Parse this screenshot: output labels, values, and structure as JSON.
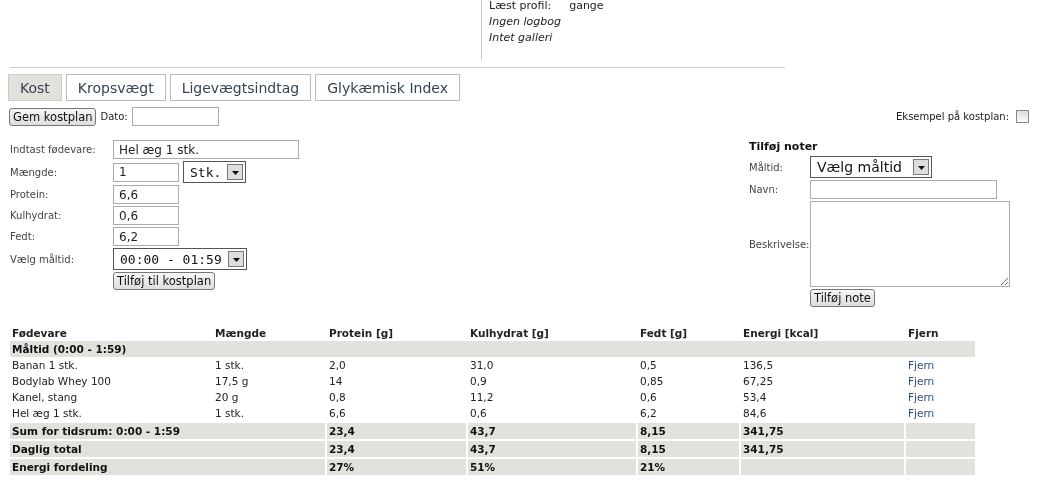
{
  "profile": {
    "stat": {
      "label": "Læst profil:",
      "value": "gange"
    },
    "links": [
      "Ingen logbog",
      "Intet galleri"
    ]
  },
  "tabs": [
    {
      "label": "Kost",
      "selected": true
    },
    {
      "label": "Kropsvægt",
      "selected": false
    },
    {
      "label": "Ligevægtsindtag",
      "selected": false
    },
    {
      "label": "Glykæmisk Index",
      "selected": false
    }
  ],
  "toolbar": {
    "save_button": "Gem kostplan",
    "date_label": "Dato:",
    "example": {
      "label": "Eksempel på kostplan:",
      "checked": false
    }
  },
  "food_form": {
    "fields": [
      {
        "kind": "text",
        "label": "Indtast fødevare:",
        "value": "Hel æg 1 stk."
      },
      {
        "kind": "amount",
        "label": "Mængde:",
        "value": "1",
        "unit": "Stk."
      },
      {
        "kind": "number",
        "label": "Protein:",
        "value": "6,6"
      },
      {
        "kind": "number",
        "label": "Kulhydrat:",
        "value": "0,6"
      },
      {
        "kind": "number",
        "label": "Fedt:",
        "value": "6,2"
      },
      {
        "kind": "select",
        "label": "Vælg måltid:",
        "value": "00:00 - 01:59"
      }
    ],
    "button": "Tilføj til kostplan"
  },
  "notes": {
    "title": "Tilføj noter",
    "fields": [
      {
        "kind": "select",
        "label": "Måltid:",
        "value": "Vælg måltid"
      },
      {
        "kind": "text",
        "label": "Navn:"
      },
      {
        "kind": "textarea",
        "label": "Beskrivelse:"
      }
    ],
    "button": "Tilføj note"
  },
  "table": {
    "columns": [
      "Fødevare",
      "Mængde",
      "Protein [g]",
      "Kulhydrat [g]",
      "Fedt [g]",
      "Energi [kcal]",
      "Fjern"
    ],
    "rows": [
      {
        "kind": "group",
        "label": "Måltid (0:00 - 1:59)"
      },
      {
        "kind": "item",
        "cells": [
          "Banan 1 stk.",
          "1 stk.",
          "2,0",
          "31,0",
          "0,5",
          "136,5"
        ],
        "action": "Fjern"
      },
      {
        "kind": "item",
        "cells": [
          "Bodylab Whey 100",
          "17,5 g",
          "14",
          "0,9",
          "0,85",
          "67,25"
        ],
        "action": "Fjern"
      },
      {
        "kind": "item",
        "cells": [
          "Kanel, stang",
          "20 g",
          "0,8",
          "11,2",
          "0,6",
          "53,4"
        ],
        "action": "Fjern"
      },
      {
        "kind": "item",
        "cells": [
          "Hel æg 1 stk.",
          "1 stk.",
          "6,6",
          "0,6",
          "6,2",
          "84,6"
        ],
        "action": "Fjern"
      },
      {
        "kind": "summary",
        "label": "Sum for tidsrum: 0:00 - 1:59",
        "values": [
          "23,4",
          "43,7",
          "8,15",
          "341,75"
        ]
      },
      {
        "kind": "summary",
        "label": "Daglig total",
        "values": [
          "23,4",
          "43,7",
          "8,15",
          "341,75"
        ]
      },
      {
        "kind": "summary",
        "label": "Energi fordeling",
        "values": [
          "27%",
          "51%",
          "21%"
        ]
      }
    ]
  }
}
